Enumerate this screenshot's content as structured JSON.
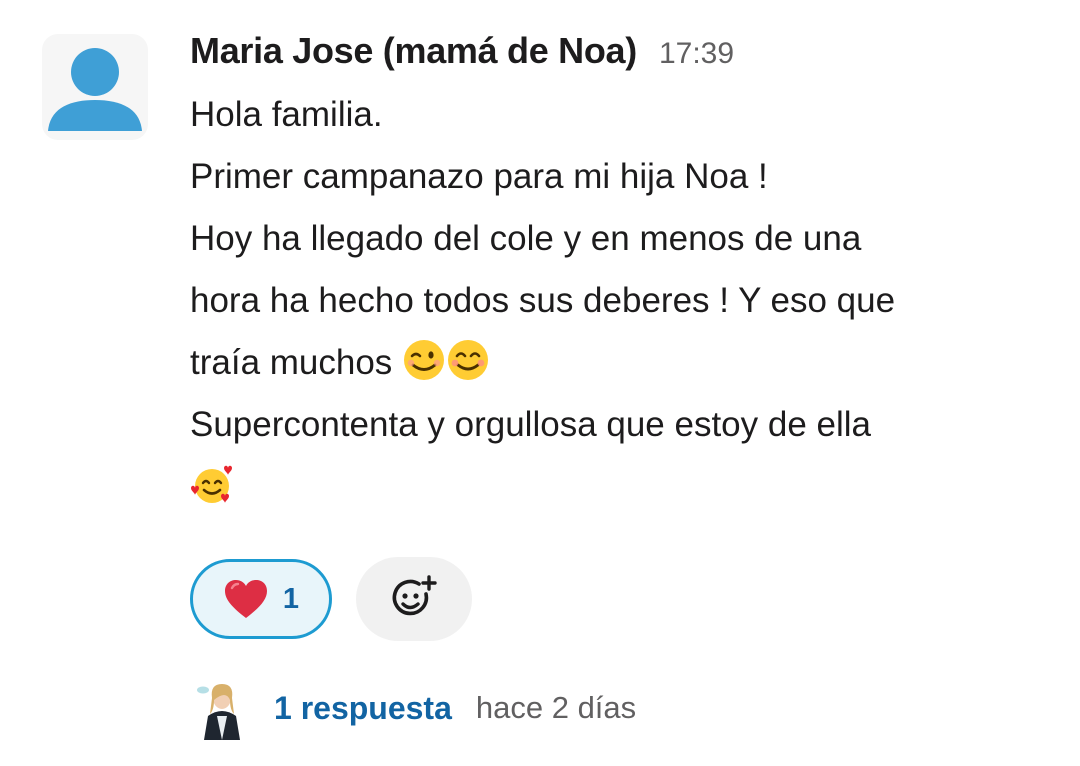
{
  "message": {
    "author": "Maria Jose (mamá de Noa)",
    "timestamp": "17:39",
    "lines": [
      "Hola familia.",
      "Primer campanazo para mi hija Noa !",
      "Hoy ha llegado del cole y en menos de una",
      "hora ha hecho todos sus deberes ! Y eso que",
      "traía muchos",
      "Supercontenta y orgullosa que estoy de ella"
    ],
    "inline_emojis": [
      "winking-face",
      "smiling-face-with-smiling-eyes",
      "smiling-face-with-hearts"
    ]
  },
  "reactions": [
    {
      "emoji": "red-heart",
      "count": "1",
      "selected": true
    }
  ],
  "add_reaction_icon": "add-reaction-icon",
  "thread": {
    "reply_count": "1 respuesta",
    "last_reply": "hace 2 días"
  },
  "colors": {
    "link": "#1264a3",
    "reaction_border": "#1d9bd1",
    "reaction_bg": "#e8f5fa",
    "avatar_placeholder": "#3f9fd6",
    "muted_text": "#616061"
  }
}
